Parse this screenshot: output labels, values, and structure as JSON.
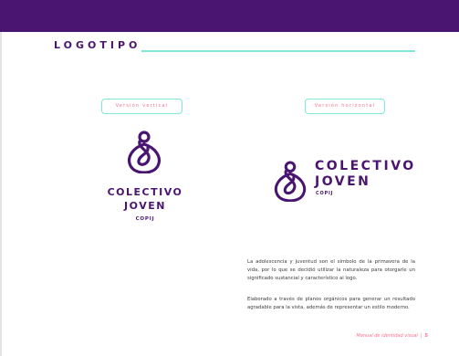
{
  "colors": {
    "brand_purple": "#4a1571",
    "accent_mint": "#7ee8d6",
    "accent_pink": "#ff6f8f"
  },
  "section": {
    "title": "LOGOTIPO"
  },
  "badges": {
    "vertical": "Versión vertical",
    "horizontal": "Versión horizontal"
  },
  "logo_vertical": {
    "icon": "drop-figure-icon",
    "line1": "COLECTIVO",
    "line2": "JOVEN",
    "sub": "COPIJ"
  },
  "logo_horizontal": {
    "icon": "drop-figure-icon",
    "line1": "COLECTIVO",
    "line2": "JOVEN",
    "sub": "COPIJ"
  },
  "body": {
    "p1": "La adolescencia y juventud son el símbolo de la primavera de la vida, por lo que se decidió utilizar la naturaleza para otorgarle un significado sustancial y característico al logo.",
    "p2": "Elaborado a través de planos orgánicos para generar un resultado agradable para la vista, además de representar un estilo moderno."
  },
  "footer": {
    "text": "Manual de identidad visual",
    "page": "5"
  }
}
